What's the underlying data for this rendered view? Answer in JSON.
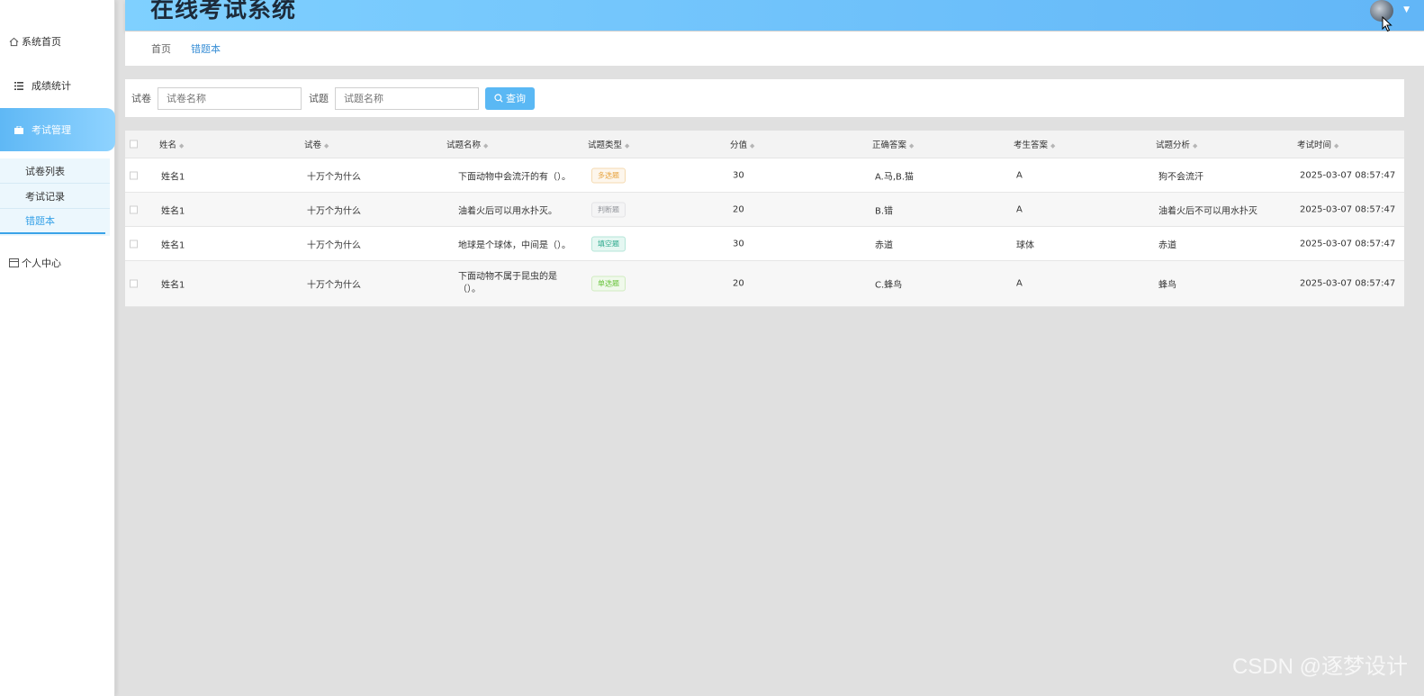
{
  "app": {
    "title": "在线考试系统"
  },
  "sidebar": {
    "items": [
      {
        "label": "系统首页",
        "icon": "home-icon"
      },
      {
        "label": "成绩统计",
        "icon": "list-icon"
      },
      {
        "label": "考试管理",
        "icon": "briefcase-icon"
      },
      {
        "label": "个人中心",
        "icon": "card-icon"
      }
    ],
    "submenu": [
      {
        "label": "试卷列表"
      },
      {
        "label": "考试记录"
      },
      {
        "label": "错题本"
      }
    ]
  },
  "breadcrumb": {
    "home": "首页",
    "current": "错题本"
  },
  "search": {
    "paper_label": "试卷",
    "paper_placeholder": "试卷名称",
    "question_label": "试题",
    "question_placeholder": "试题名称",
    "button_label": "查询"
  },
  "table": {
    "headers": [
      "姓名",
      "试卷",
      "试题名称",
      "试题类型",
      "分值",
      "正确答案",
      "考生答案",
      "试题分析",
      "考试时间"
    ],
    "rows": [
      {
        "name": "姓名1",
        "paper": "十万个为什么",
        "question": "下面动物中会流汗的有（）。",
        "type": "多选题",
        "score": "30",
        "correct": "A.马,B.猫",
        "answer": "A",
        "analysis": "狗不会流汗",
        "time": "2025-03-07 08:57:47"
      },
      {
        "name": "姓名1",
        "paper": "十万个为什么",
        "question": "油着火后可以用水扑灭。",
        "type": "判断题",
        "score": "20",
        "correct": "B.错",
        "answer": "A",
        "analysis": "油着火后不可以用水扑灭",
        "time": "2025-03-07 08:57:47"
      },
      {
        "name": "姓名1",
        "paper": "十万个为什么",
        "question": "地球是个球体，中间是（）。",
        "type": "填空题",
        "score": "30",
        "correct": "赤道",
        "answer": "球体",
        "analysis": "赤道",
        "time": "2025-03-07 08:57:47"
      },
      {
        "name": "姓名1",
        "paper": "十万个为什么",
        "question": "下面动物不属于昆虫的是（）。",
        "type": "单选题",
        "score": "20",
        "correct": "C.蜂鸟",
        "answer": "A",
        "analysis": "蜂鸟",
        "time": "2025-03-07 08:57:47"
      }
    ]
  },
  "watermark": "CSDN @逐梦设计",
  "colors": {
    "accent": "#5ab8f4",
    "header_start": "#7fd0ff",
    "header_end": "#62b6f7"
  }
}
